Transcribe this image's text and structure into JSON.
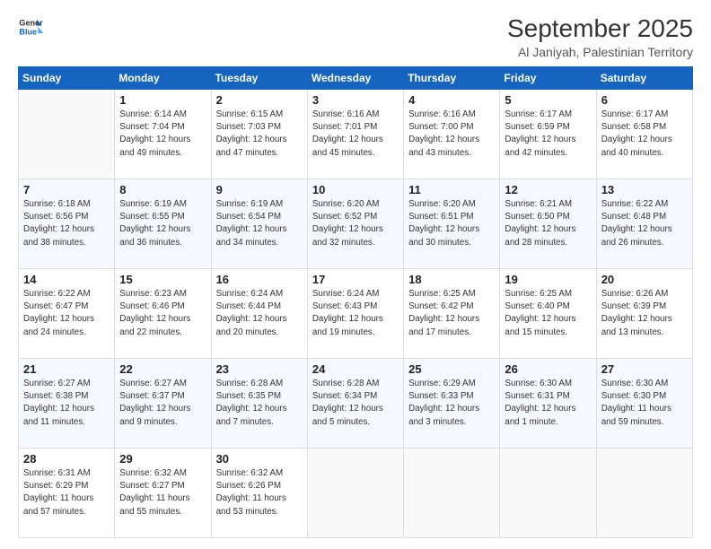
{
  "header": {
    "logo_line1": "General",
    "logo_line2": "Blue",
    "title": "September 2025",
    "subtitle": "Al Janiyah, Palestinian Territory"
  },
  "days_of_week": [
    "Sunday",
    "Monday",
    "Tuesday",
    "Wednesday",
    "Thursday",
    "Friday",
    "Saturday"
  ],
  "weeks": [
    [
      {
        "num": "",
        "detail": ""
      },
      {
        "num": "1",
        "detail": "Sunrise: 6:14 AM\nSunset: 7:04 PM\nDaylight: 12 hours\nand 49 minutes."
      },
      {
        "num": "2",
        "detail": "Sunrise: 6:15 AM\nSunset: 7:03 PM\nDaylight: 12 hours\nand 47 minutes."
      },
      {
        "num": "3",
        "detail": "Sunrise: 6:16 AM\nSunset: 7:01 PM\nDaylight: 12 hours\nand 45 minutes."
      },
      {
        "num": "4",
        "detail": "Sunrise: 6:16 AM\nSunset: 7:00 PM\nDaylight: 12 hours\nand 43 minutes."
      },
      {
        "num": "5",
        "detail": "Sunrise: 6:17 AM\nSunset: 6:59 PM\nDaylight: 12 hours\nand 42 minutes."
      },
      {
        "num": "6",
        "detail": "Sunrise: 6:17 AM\nSunset: 6:58 PM\nDaylight: 12 hours\nand 40 minutes."
      }
    ],
    [
      {
        "num": "7",
        "detail": "Sunrise: 6:18 AM\nSunset: 6:56 PM\nDaylight: 12 hours\nand 38 minutes."
      },
      {
        "num": "8",
        "detail": "Sunrise: 6:19 AM\nSunset: 6:55 PM\nDaylight: 12 hours\nand 36 minutes."
      },
      {
        "num": "9",
        "detail": "Sunrise: 6:19 AM\nSunset: 6:54 PM\nDaylight: 12 hours\nand 34 minutes."
      },
      {
        "num": "10",
        "detail": "Sunrise: 6:20 AM\nSunset: 6:52 PM\nDaylight: 12 hours\nand 32 minutes."
      },
      {
        "num": "11",
        "detail": "Sunrise: 6:20 AM\nSunset: 6:51 PM\nDaylight: 12 hours\nand 30 minutes."
      },
      {
        "num": "12",
        "detail": "Sunrise: 6:21 AM\nSunset: 6:50 PM\nDaylight: 12 hours\nand 28 minutes."
      },
      {
        "num": "13",
        "detail": "Sunrise: 6:22 AM\nSunset: 6:48 PM\nDaylight: 12 hours\nand 26 minutes."
      }
    ],
    [
      {
        "num": "14",
        "detail": "Sunrise: 6:22 AM\nSunset: 6:47 PM\nDaylight: 12 hours\nand 24 minutes."
      },
      {
        "num": "15",
        "detail": "Sunrise: 6:23 AM\nSunset: 6:46 PM\nDaylight: 12 hours\nand 22 minutes."
      },
      {
        "num": "16",
        "detail": "Sunrise: 6:24 AM\nSunset: 6:44 PM\nDaylight: 12 hours\nand 20 minutes."
      },
      {
        "num": "17",
        "detail": "Sunrise: 6:24 AM\nSunset: 6:43 PM\nDaylight: 12 hours\nand 19 minutes."
      },
      {
        "num": "18",
        "detail": "Sunrise: 6:25 AM\nSunset: 6:42 PM\nDaylight: 12 hours\nand 17 minutes."
      },
      {
        "num": "19",
        "detail": "Sunrise: 6:25 AM\nSunset: 6:40 PM\nDaylight: 12 hours\nand 15 minutes."
      },
      {
        "num": "20",
        "detail": "Sunrise: 6:26 AM\nSunset: 6:39 PM\nDaylight: 12 hours\nand 13 minutes."
      }
    ],
    [
      {
        "num": "21",
        "detail": "Sunrise: 6:27 AM\nSunset: 6:38 PM\nDaylight: 12 hours\nand 11 minutes."
      },
      {
        "num": "22",
        "detail": "Sunrise: 6:27 AM\nSunset: 6:37 PM\nDaylight: 12 hours\nand 9 minutes."
      },
      {
        "num": "23",
        "detail": "Sunrise: 6:28 AM\nSunset: 6:35 PM\nDaylight: 12 hours\nand 7 minutes."
      },
      {
        "num": "24",
        "detail": "Sunrise: 6:28 AM\nSunset: 6:34 PM\nDaylight: 12 hours\nand 5 minutes."
      },
      {
        "num": "25",
        "detail": "Sunrise: 6:29 AM\nSunset: 6:33 PM\nDaylight: 12 hours\nand 3 minutes."
      },
      {
        "num": "26",
        "detail": "Sunrise: 6:30 AM\nSunset: 6:31 PM\nDaylight: 12 hours\nand 1 minute."
      },
      {
        "num": "27",
        "detail": "Sunrise: 6:30 AM\nSunset: 6:30 PM\nDaylight: 11 hours\nand 59 minutes."
      }
    ],
    [
      {
        "num": "28",
        "detail": "Sunrise: 6:31 AM\nSunset: 6:29 PM\nDaylight: 11 hours\nand 57 minutes."
      },
      {
        "num": "29",
        "detail": "Sunrise: 6:32 AM\nSunset: 6:27 PM\nDaylight: 11 hours\nand 55 minutes."
      },
      {
        "num": "30",
        "detail": "Sunrise: 6:32 AM\nSunset: 6:26 PM\nDaylight: 11 hours\nand 53 minutes."
      },
      {
        "num": "",
        "detail": ""
      },
      {
        "num": "",
        "detail": ""
      },
      {
        "num": "",
        "detail": ""
      },
      {
        "num": "",
        "detail": ""
      }
    ]
  ]
}
